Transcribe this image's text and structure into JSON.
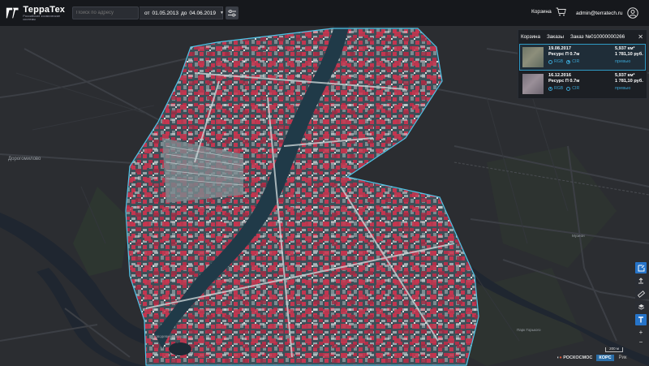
{
  "header": {
    "logo_title": "ТерраТех",
    "logo_subtitle": "Российские космические системы",
    "search_placeholder": "Поиск по адресу",
    "date_from_label": "от",
    "date_from": "01.05.2013",
    "date_to_label": "до",
    "date_to": "04.06.2019",
    "cart_label": "Корзина",
    "user_email": "admin@terratech.ru"
  },
  "panel": {
    "tabs": [
      "Корзина",
      "Заказы",
      "Заказ №010000000266"
    ],
    "items": [
      {
        "date": "19.08.2017",
        "satellite": "Ресурс П 0.7м",
        "area": "5,937 км²",
        "price": "1 781,10 руб.",
        "radio_rgb": "RGB",
        "radio_cir": "CIR",
        "selected_mode": "CIR",
        "preview": "превью",
        "selected": true
      },
      {
        "date": "16.12.2016",
        "satellite": "Ресурс П 0.7м",
        "area": "5,937 км²",
        "price": "1 781,10 руб.",
        "radio_rgb": "RGB",
        "radio_cir": "CIR",
        "selected_mode": "RGB",
        "preview": "превью",
        "selected": false
      }
    ]
  },
  "map": {
    "labels": [
      {
        "text": "Дорогомилово"
      },
      {
        "text": "Новодевичьи пруды"
      },
      {
        "text": "Парк Горького"
      },
      {
        "text": "Музеон"
      }
    ],
    "scale_label": "200 м"
  },
  "toolbar": {
    "zoom_in": "+",
    "zoom_out": "−"
  },
  "footer": {
    "partner1": "РОСКОСМОС",
    "partner2": "КОРС",
    "partner3": "Рик"
  },
  "colors": {
    "accent": "#2f9ac4",
    "header_bg": "#16181c",
    "aoi_stroke": "#4fc3e6",
    "vegetation": "#c0324a"
  }
}
